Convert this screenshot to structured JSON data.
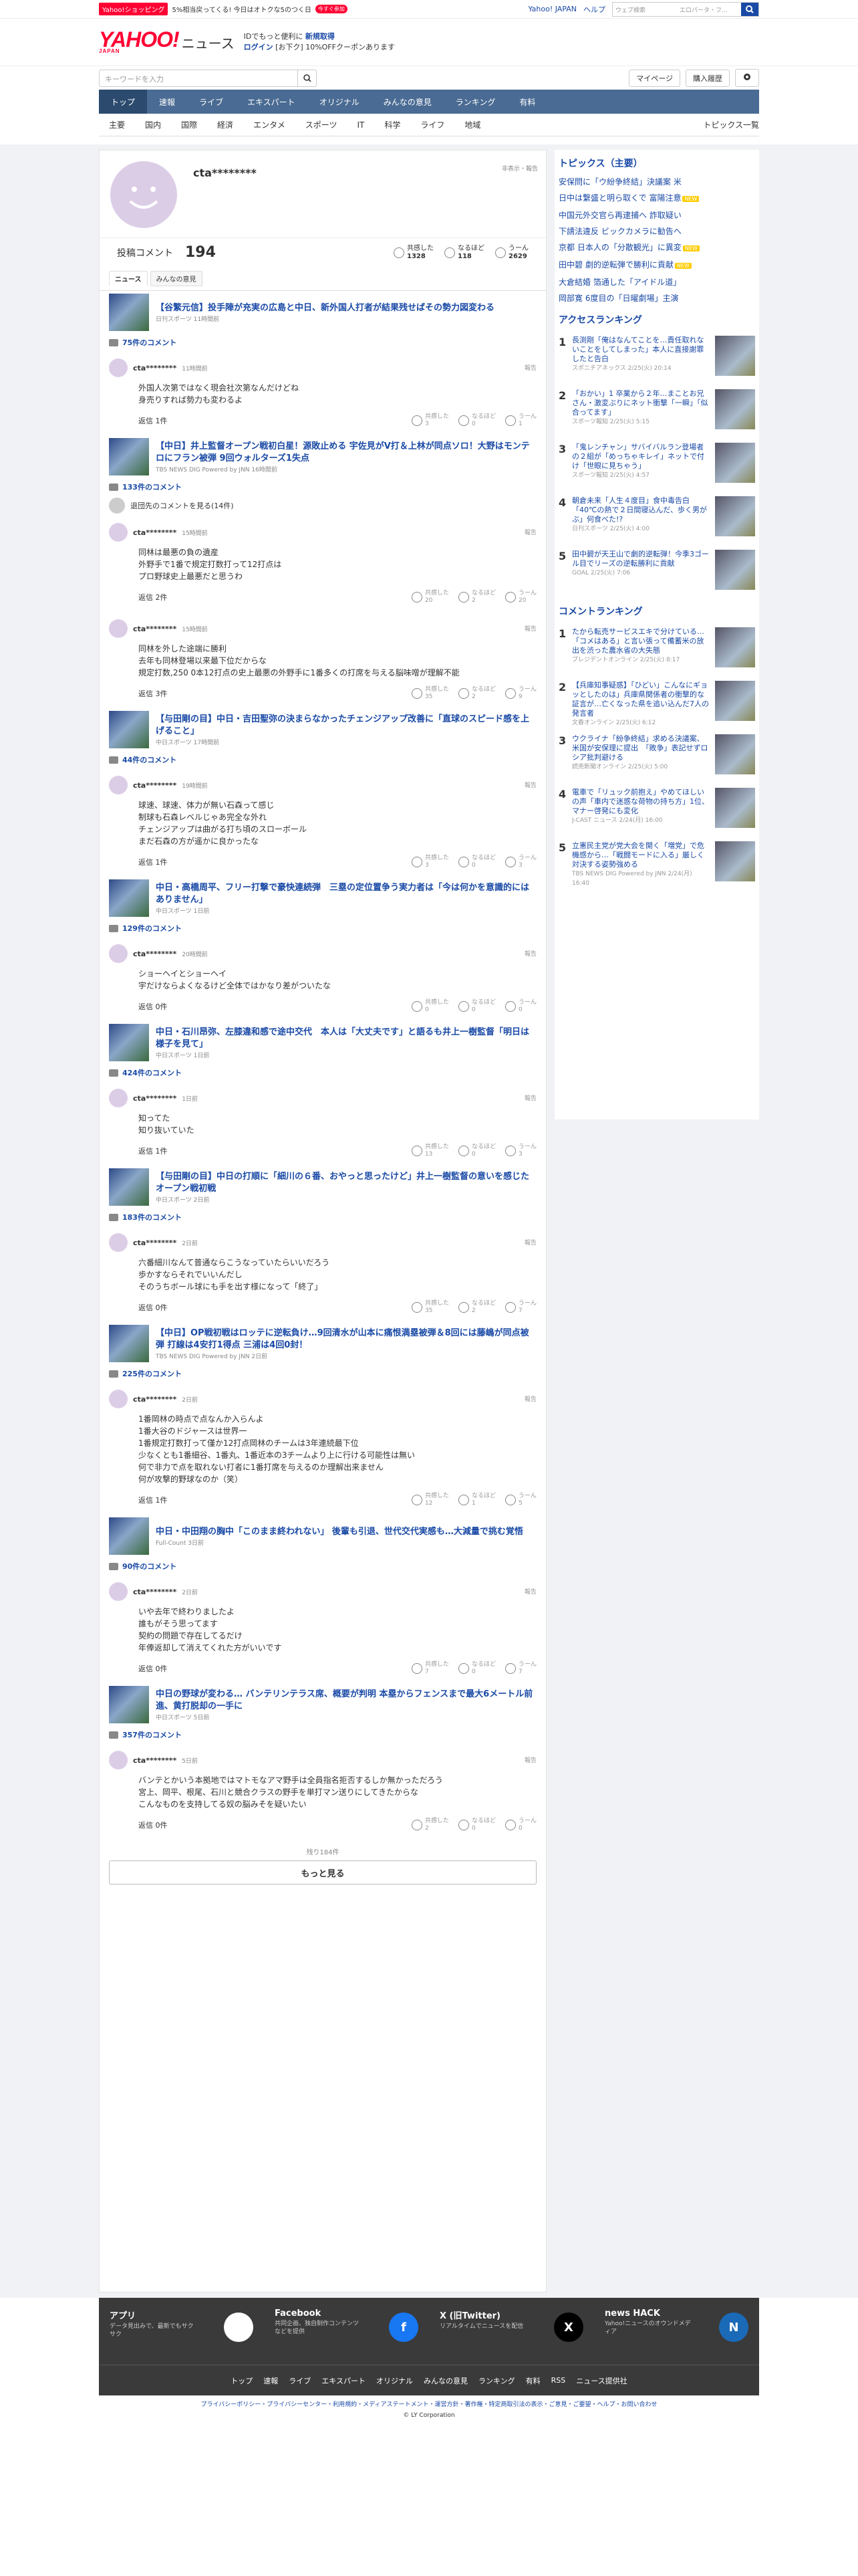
{
  "promo": {
    "badge": "Yahoo!ショッピング",
    "text": "5%相当戻ってくる! 今日はオトクな5のつく日",
    "tag": "今すぐ参加"
  },
  "top_links": {
    "yj": "Yahoo! JAPAN",
    "help": "ヘルプ"
  },
  "web_search": {
    "placeholder": "ウェブ検索",
    "value": "エロパータ・フ..."
  },
  "brand": {
    "logo": "YAHOO!",
    "logo_sub": "JAPAN",
    "news": "ニュース",
    "promo1": "IDでもっと便利に",
    "promo1_link": "新規取得",
    "login": "ログイン",
    "promo2": "[お下ク] 10%OFFクーポンあります"
  },
  "site_search": {
    "placeholder": "キーワードを入力"
  },
  "utility": {
    "my": "マイページ",
    "history": "購入履歴"
  },
  "nav": [
    "トップ",
    "速報",
    "ライブ",
    "エキスパート",
    "オリジナル",
    "みんなの意見",
    "ランキング",
    "有料"
  ],
  "subnav": [
    "主要",
    "国内",
    "国際",
    "経済",
    "エンタメ",
    "スポーツ",
    "IT",
    "科学",
    "ライフ",
    "地域"
  ],
  "subnav_right": "トピックス一覧",
  "profile": {
    "name": "cta********",
    "private": "非表示・報告",
    "label": "投稿コメント",
    "count": "194",
    "stats": [
      {
        "label": "共感した",
        "value": "1328"
      },
      {
        "label": "なるほど",
        "value": "118"
      },
      {
        "label": "うーん",
        "value": "2629"
      }
    ]
  },
  "tabs": [
    "ニュース",
    "みんなの意見"
  ],
  "articles": [
    {
      "title": "【谷繁元信】投手陣が充実の広島と中日、新外国人打者が結果残せばその勢力図変わる",
      "source": "日刊スポーツ 11時間前",
      "count": "75件のコメント",
      "comments": [
        {
          "user": "cta********",
          "time": "11時間前",
          "text": [
            "外国人次第ではなく現会社次第なんだけどね",
            "身売りすれば勢力も変わるよ"
          ],
          "reply": "返信 1件",
          "r": [
            "3",
            "0",
            "1"
          ]
        }
      ]
    },
    {
      "title": "【中日】井上監督オープン戦初白星！源敗止める 宇佐見がV打＆上林が同点ソロ！大野はモンテロにフラン被弾 9回ウォルターズ1失点",
      "source": "TBS NEWS DIG Powered by JNN 16時間前",
      "count": "133件のコメント",
      "hidden": "退団先のコメントを見る(14件)",
      "comments": [
        {
          "user": "cta********",
          "time": "15時間前",
          "text": [
            "同林は最悪の負の遺産",
            "外野手で1番で規定打数打って12打点は",
            "プロ野球史上最悪だと思うわ"
          ],
          "reply": "返信 2件",
          "r": [
            "20",
            "2",
            "20"
          ]
        },
        {
          "user": "cta********",
          "time": "15時間前",
          "text": [
            "同林を外した途端に勝利",
            "去年も同林登場以来最下位だからな",
            "規定打数,250 0本12打点の史上最悪の外野手に1番多くの打席を与える脳味噌が理解不能"
          ],
          "reply": "返信 3件",
          "r": [
            "35",
            "2",
            "9"
          ]
        }
      ]
    },
    {
      "title": "【与田剛の目】中日・吉田聖弥の決まらなかったチェンジアップ改善に「直球のスピード感を上げること」",
      "source": "中日スポーツ 17時間前",
      "count": "44件のコメント",
      "comments": [
        {
          "user": "cta********",
          "time": "19時間前",
          "text": [
            "球速、球速、体力が無い石森って感じ",
            "制球も石森レベルじゃあ完全な外れ",
            "チェンジアップは曲がる打ち頃のスローボール",
            "まだ石森の方が遥かに良かったな"
          ],
          "reply": "返信 1件",
          "r": [
            "3",
            "0",
            "3"
          ]
        }
      ]
    },
    {
      "title": "中日・高橋周平、フリー打撃で豪快連続弾　三塁の定位置争う実力者は「今は何かを意識的にはありません」",
      "source": "中日スポーツ 1日前",
      "count": "129件のコメント",
      "comments": [
        {
          "user": "cta********",
          "time": "20時間前",
          "text": [
            "ショーヘイとショーヘイ",
            "宇だけならよくなるけど全体ではかなり差がついたな"
          ],
          "reply": "返信 0件",
          "r": [
            "0",
            "0",
            "0"
          ]
        }
      ]
    },
    {
      "title": "中日・石川昂弥、左膝違和感で途中交代　本人は「大丈夫です」と語るも井上一樹監督「明日は様子を見て」",
      "source": "中日スポーツ 1日前",
      "count": "424件のコメント",
      "comments": [
        {
          "user": "cta********",
          "time": "1日前",
          "text": [
            "知ってた",
            "知り抜いていた"
          ],
          "reply": "返信 1件",
          "r": [
            "13",
            "0",
            "3"
          ]
        }
      ]
    },
    {
      "title": "【与田剛の目】中日の打順に「細川の６番、おやっと思ったけど」井上一樹監督の意いを感じたオープン戦初戦",
      "source": "中日スポーツ 2日前",
      "count": "183件のコメント",
      "comments": [
        {
          "user": "cta********",
          "time": "2日前",
          "text": [
            "六番細川なんて普通ならこうなっていたらいいだろう",
            "歩かすならそれでいいんだし",
            "そのうちボール球にも手を出す様になって「終了」"
          ],
          "reply": "返信 0件",
          "r": [
            "35",
            "2",
            "7"
          ]
        }
      ]
    },
    {
      "title": "【中日】OP戦初戦はロッテに逆転負け…9回清水が山本に痛恨満塁被弾＆8回には藤嶋が同点被弾 打線は4安打1得点 三浦は4回0封！",
      "source": "TBS NEWS DIG Powered by JNN 2日前",
      "count": "225件のコメント",
      "comments": [
        {
          "user": "cta********",
          "time": "2日前",
          "text": [
            "1番岡林の時点で点なんか入らんよ",
            "1番大谷のドジャースは世界一",
            "1番規定打数打って僅か12打点岡林のチームは3年連続最下位",
            "少なくとも1番細谷、1番丸、1番近本の3チームより上に行ける可能性は無い",
            "何で非力で点を取れない打者に1番打席を与えるのか理解出来ません",
            "何が攻撃的野球なのか（笑）"
          ],
          "reply": "返信 1件",
          "r": [
            "12",
            "1",
            "5"
          ]
        }
      ]
    },
    {
      "title": "中日・中田翔の胸中「このまま終われない」 後輩も引退、世代交代実感も…大減量で挑む覚悟",
      "source": "Full-Count 3日前",
      "count": "90件のコメント",
      "comments": [
        {
          "user": "cta********",
          "time": "2日前",
          "text": [
            "いや去年で終わりましたよ",
            "誰もがそう思ってます",
            "契約の問題で存在してるだけ",
            "年俸返却して消えてくれた方がいいです"
          ],
          "reply": "返信 0件",
          "r": [
            "7",
            "0",
            "7"
          ]
        }
      ]
    },
    {
      "title": "中日の野球が変わる… バンテリンテラス席、概要が判明 本塁からフェンスまで最大6メートル前進、黄打脱却の一手に",
      "source": "中日スポーツ 5日前",
      "count": "357件のコメント",
      "comments": [
        {
          "user": "cta********",
          "time": "5日前",
          "text": [
            "バンテとかいう本拠地ではマトモなアマ野手は全員指名拒否するしか無かっただろう",
            "宮上、岡平、根尾、石川と競合クラスの野手を単打マン送りにしてきたからな",
            "こんなものを支持してる奴の脳みそを疑いたい"
          ],
          "reply": "返信 0件",
          "r": [
            "2",
            "0",
            "0"
          ]
        }
      ]
    }
  ],
  "more_info": "残り184件",
  "more_button": "もっと見る",
  "side": {
    "topics_h": "トピックス（主要）",
    "topics": [
      {
        "t": "安保問に「ウ紛争終結」決議案 米",
        "n": false
      },
      {
        "t": "日中は繋盛と明ら取くで 富陽注意",
        "n": true
      },
      {
        "t": "中国元外交官ら再逮捕へ 詐取疑い",
        "n": false
      },
      {
        "t": "下請法違反 ビックカメラに勧告へ",
        "n": false
      },
      {
        "t": "京都 日本人の「分散観光」に異変",
        "n": true
      },
      {
        "t": "田中碧 劇的逆転弾で勝利に貢献",
        "n": true
      },
      {
        "t": "大倉結婚 箔通した「アイドル道」",
        "n": false
      },
      {
        "t": "岡部寛 6度目の「日曜劇場」主演",
        "n": false
      }
    ],
    "access_h": "アクセスランキング",
    "access": [
      {
        "n": "1",
        "t": "長渕剛「俺はなんてことを…責任取れないことをしてしまった」本人に直接謝罪したと告白",
        "s": "スポニチアネックス 2/25(火) 20:14"
      },
      {
        "n": "2",
        "t": "「おかい」1 卒業から２年…まことお兄さん・激変ぶりにネット衝撃「一瞬」「似合ってます」",
        "s": "スポーツ報知 2/25(火) 5:15"
      },
      {
        "n": "3",
        "t": "「鬼レンチャン」サバイバルラン登場者の２組が「めっちゃキレイ」ネットで付け「世眼に見ちゃう」",
        "s": "スポーツ報知 2/25(火) 4:57"
      },
      {
        "n": "4",
        "t": "朝倉未来「人生４度目」食中毒告白「40℃の熱で２日間寝込んだ、歩く男がぶ」何食べた!?",
        "s": "日刊スポーツ 2/25(火) 4:00"
      },
      {
        "n": "5",
        "t": "田中碧が天王山で劇的逆転弾！今季3ゴール目でリーズの逆転勝利に貢献",
        "s": "GOAL 2/25(火) 7:06"
      }
    ],
    "comment_h": "コメントランキング",
    "crank": [
      {
        "n": "1",
        "t": "たから転売サービスエキで分けている…「コメはある」と言い張って備蓄米の放出を渋った農水省の大失態",
        "s": "プレジデントオンライン 2/25(火) 8:17"
      },
      {
        "n": "2",
        "t": "【兵庫知事疑惑】「ひどい」こんなにギョッとしたのは」兵庫県関係者の衝撃的な証言が…亡くなった県を追い込んだ7人の発言者",
        "s": "文春オンライン 2/25(火) 6:12"
      },
      {
        "n": "3",
        "t": "ウクライナ「紛争終結」求める決議案、米国が安保理に提出　「敗争」表記せずロシア批判避ける",
        "s": "読売新聞オンライン 2/25(火) 5:00"
      },
      {
        "n": "4",
        "t": "電車で「リュック前抱え」やめてほしいの声「車内で迷惑な荷物の持ち方」1位、マナー啓発にも変化",
        "s": "J-CAST ニュース 2/24(月) 16:00"
      },
      {
        "n": "5",
        "t": "立憲民主党が党大会を開く「増党」で危機感から…「戦闘モードに入る」厳しく対決する姿勢強める",
        "s": "TBS NEWS DIG Powered by JNN 2/24(月) 16:40"
      }
    ]
  },
  "footer": {
    "apps": [
      {
        "h": "アプリ",
        "d": "データ見出みで、最新でもサクサク",
        "icon": "app-icon"
      },
      {
        "h": "Facebook",
        "d": "共同企画、独自制作コンテンツなどを提供",
        "icon": "facebook-icon"
      },
      {
        "h": "X (旧Twitter)",
        "d": "リアルタイムでニュースを配信",
        "icon": "x-icon"
      },
      {
        "h": "news HACK",
        "d": "Yahoo!ニュースのオウンドメディア",
        "icon": "newshack-icon"
      }
    ],
    "links": [
      "トップ",
      "速報",
      "ライブ",
      "エキスパート",
      "オリジナル",
      "みんなの意見",
      "ランキング",
      "有料",
      "RSS",
      "ニュース提供社"
    ],
    "legal": "プライバシーポリシー・プライバシーセンター・利用規約・メディアステートメント・運営方針・著作権・特定商取引法の表示・ご意見・ご要望・ヘルプ・お問い合わせ",
    "copy": "© LY Corporation"
  }
}
